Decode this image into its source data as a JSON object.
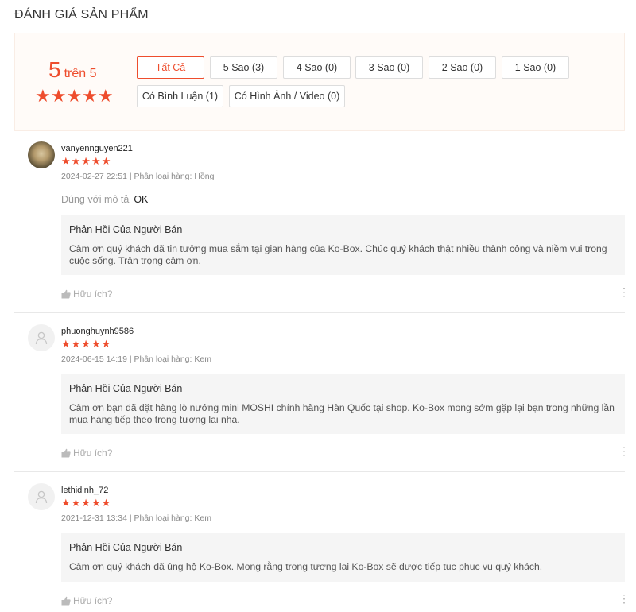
{
  "section_title": "ĐÁNH GIÁ SẢN PHẨM",
  "overview": {
    "rating": "5",
    "rating_suffix": "trên 5",
    "stars": "★★★★★",
    "filters": [
      {
        "label": "Tất Cả",
        "active": true
      },
      {
        "label": "5 Sao (3)"
      },
      {
        "label": "4 Sao (0)"
      },
      {
        "label": "3 Sao (0)"
      },
      {
        "label": "2 Sao (0)"
      },
      {
        "label": "1 Sao (0)"
      },
      {
        "label": "Có Bình Luận (1)"
      },
      {
        "label": "Có Hình Ảnh / Video (0)"
      }
    ]
  },
  "reviews": [
    {
      "username": "vanyennguyen221",
      "stars": "★★★★★",
      "meta": "2024-02-27 22:51 | Phân loại hàng: Hồng",
      "attr_key": "Đúng với mô tả",
      "attr_value": "OK",
      "seller_title": "Phản Hồi Của Người Bán",
      "seller_text": "Cảm ơn quý khách đã tin tưởng mua sắm tại gian hàng của Ko-Box. Chúc quý khách thật nhiều thành công và niềm vui trong cuộc sống. Trân trọng cảm ơn.",
      "helpful": "Hữu ích?"
    },
    {
      "username": "phuonghuynh9586",
      "stars": "★★★★★",
      "meta": "2024-06-15 14:19 | Phân loại hàng: Kem",
      "seller_title": "Phản Hồi Của Người Bán",
      "seller_text": "Cảm ơn bạn đã đặt hàng lò nướng mini MOSHI chính hãng Hàn Quốc tại shop. Ko-Box mong sớm gặp lại bạn trong những lần mua hàng tiếp theo trong tương lai nha.",
      "helpful": "Hữu ích?"
    },
    {
      "username": "lethidinh_72",
      "stars": "★★★★★",
      "meta": "2021-12-31 13:34 | Phân loại hàng: Kem",
      "seller_title": "Phản Hồi Của Người Bán",
      "seller_text": "Cảm ơn quý khách đã ủng hộ Ko-Box. Mong rằng trong tương lai Ko-Box sẽ được tiếp tục phục vụ quý khách.",
      "helpful": "Hữu ích?"
    }
  ],
  "colors": {
    "accent": "#ee4d2d",
    "overview_bg": "#fffbf8",
    "seller_bg": "#f5f5f5"
  },
  "icons": {
    "helpful": "thumbs-up-icon",
    "more": "more-vertical-icon",
    "avatar_placeholder": "user-icon"
  }
}
